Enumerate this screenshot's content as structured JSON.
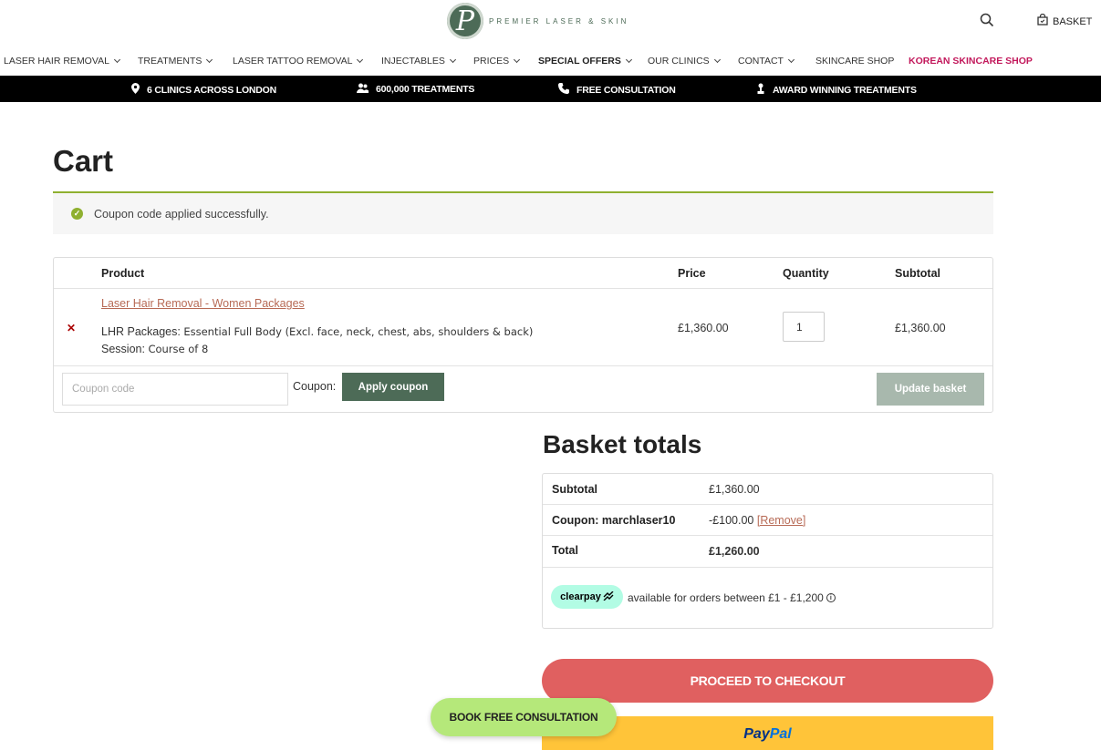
{
  "header": {
    "logo_letter": "P",
    "logo_text": "PREMIER LASER & SKIN",
    "basket_label": "BASKET"
  },
  "nav": [
    {
      "label": "LASER HAIR REMOVAL",
      "dropdown": true
    },
    {
      "label": "TREATMENTS",
      "dropdown": true
    },
    {
      "label": "LASER TATTOO REMOVAL",
      "dropdown": true
    },
    {
      "label": "INJECTABLES",
      "dropdown": true
    },
    {
      "label": "PRICES",
      "dropdown": true
    },
    {
      "label": "SPECIAL OFFERS",
      "dropdown": true
    },
    {
      "label": "OUR CLINICS",
      "dropdown": true
    },
    {
      "label": "CONTACT",
      "dropdown": true
    },
    {
      "label": "SKINCARE SHOP",
      "dropdown": false
    },
    {
      "label": "KOREAN SKINCARE SHOP",
      "dropdown": false
    }
  ],
  "infobar": [
    {
      "icon": "map-pin-icon",
      "label": "6 CLINICS ACROSS LONDON"
    },
    {
      "icon": "users-icon",
      "label": "600,000 TREATMENTS"
    },
    {
      "icon": "phone-icon",
      "label": "FREE CONSULTATION"
    },
    {
      "icon": "award-icon",
      "label": "AWARD WINNING TREATMENTS"
    }
  ],
  "cart": {
    "title": "Cart",
    "notice": "Coupon code applied successfully.",
    "columns": {
      "product": "Product",
      "price": "Price",
      "quantity": "Quantity",
      "subtotal": "Subtotal"
    },
    "item": {
      "name": "Laser Hair Removal - Women Packages",
      "package_label": "LHR Packages:",
      "package_value": "Essential Full Body (Excl. face, neck, chest, abs, shoulders & back)",
      "session_label": "Session:",
      "session_value": "Course of 8",
      "price": "£1,360.00",
      "quantity": "1",
      "subtotal": "£1,360.00"
    },
    "coupon_placeholder": "Coupon code",
    "coupon_label": "Coupon:",
    "apply_label": "Apply coupon",
    "update_label": "Update basket"
  },
  "totals": {
    "title": "Basket totals",
    "subtotal_label": "Subtotal",
    "subtotal_value": "£1,360.00",
    "coupon_label": "Coupon: marchlaser10",
    "coupon_value": "-£100.00",
    "remove_label": "[Remove]",
    "total_label": "Total",
    "total_value": "£1,260.00",
    "clearpay_label": "clearpay",
    "clearpay_text": "available for orders between £1 - £1,200"
  },
  "checkout_label": "PROCEED TO CHECKOUT",
  "paypal": {
    "part1": "Pay",
    "part2": "Pal"
  },
  "consult_label": "BOOK FREE CONSULTATION",
  "colors": {
    "brand_green": "#4d6b57",
    "accent_lime": "#8fb030",
    "checkout_red": "#e06060",
    "paypal_yellow": "#ffc439",
    "korean_pink": "#c2185b"
  }
}
